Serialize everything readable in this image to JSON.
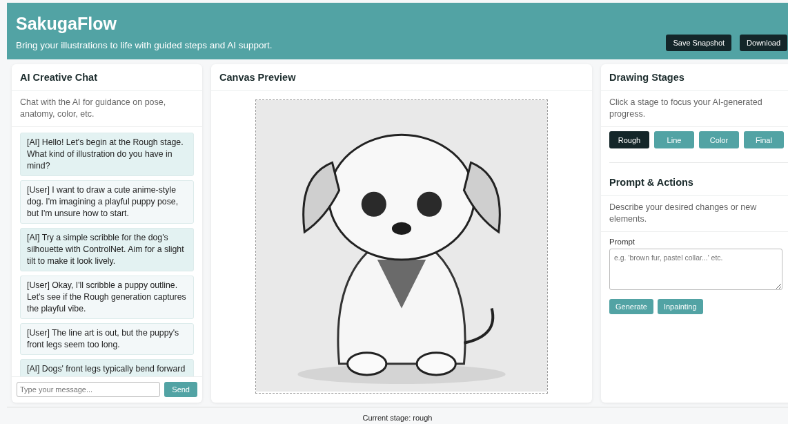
{
  "header": {
    "title": "SakugaFlow",
    "subtitle": "Bring your illustrations to life with guided steps and AI support.",
    "buttons": [
      "Save Snapshot",
      "Download"
    ]
  },
  "chat": {
    "title": "AI Creative Chat",
    "description": "Chat with the AI for guidance on pose, anatomy, color, etc.",
    "messages": [
      {
        "kind": "ai",
        "text": "[AI] Hello! Let's begin at the Rough stage. What kind of illustration do you have in mind?"
      },
      {
        "kind": "user",
        "text": "[User] I want to draw a cute anime-style dog. I'm imagining a playful puppy pose, but I'm unsure how to start."
      },
      {
        "kind": "ai",
        "text": "[AI] Try a simple scribble for the dog's silhouette with ControlNet. Aim for a slight tilt to make it look lively."
      },
      {
        "kind": "user",
        "text": "[User] Okay, I'll scribble a puppy outline. Let's see if the Rough generation captures the playful vibe."
      },
      {
        "kind": "user",
        "text": "[User] The line art is out, but the puppy's front legs seem too long."
      },
      {
        "kind": "ai",
        "text": "[AI] Dogs' front legs typically bend forward"
      }
    ],
    "input_placeholder": "Type your message...",
    "send": "Send"
  },
  "canvas": {
    "title": "Canvas Preview"
  },
  "stages": {
    "title": "Drawing Stages",
    "description": "Click a stage to focus your AI-generated progress.",
    "items": [
      {
        "label": "Rough",
        "selected": true
      },
      {
        "label": "Line",
        "selected": false
      },
      {
        "label": "Color",
        "selected": false
      },
      {
        "label": "Final",
        "selected": false
      }
    ]
  },
  "prompt": {
    "title": "Prompt & Actions",
    "description": "Describe your desired changes or new elements.",
    "label": "Prompt",
    "placeholder": "e.g. 'brown fur, pastel collar...' etc.",
    "buttons": [
      "Generate",
      "Inpainting"
    ]
  },
  "status": "Current stage: rough"
}
